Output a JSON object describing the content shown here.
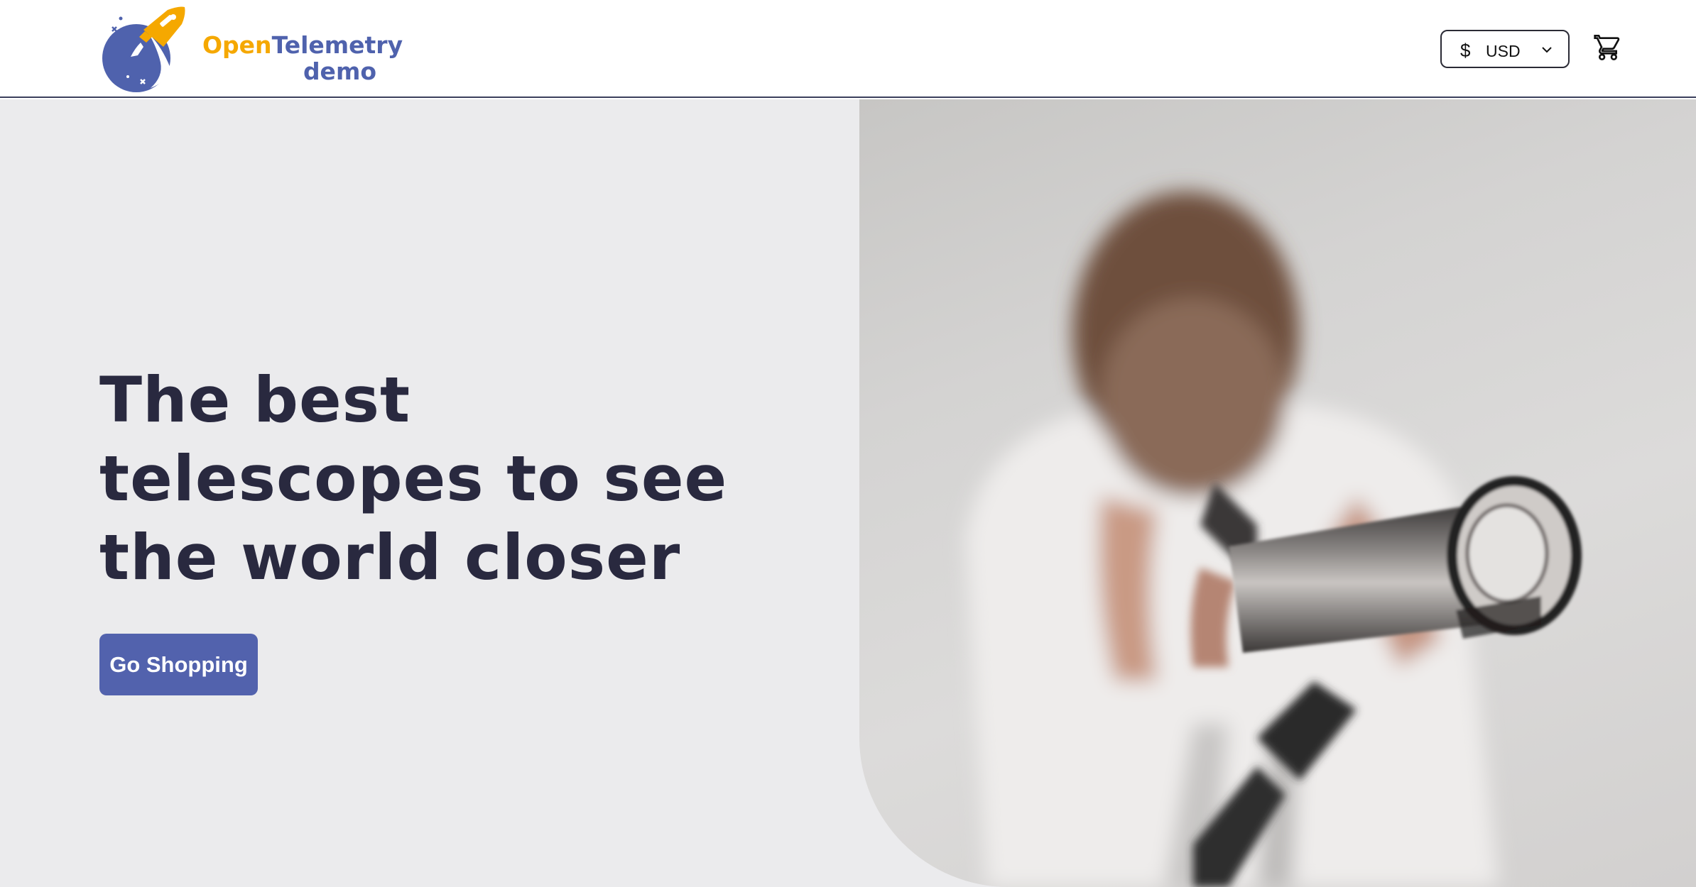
{
  "header": {
    "logo": {
      "word_open": "Open",
      "word_telemetry": "Telemetry",
      "word_demo": "demo",
      "icon": "rocket-planet-logo"
    },
    "currency_selector": {
      "symbol": "$",
      "code": "USD",
      "icon": "chevron-down-icon"
    },
    "cart": {
      "icon": "shopping-cart-icon"
    }
  },
  "hero": {
    "title": "The best telescopes to see the world closer",
    "button_label": "Go Shopping",
    "image": "child-looking-through-telescope"
  },
  "colors": {
    "brand_blue": "#5262ad",
    "brand_orange": "#f5a800",
    "heading": "#29293f",
    "hero_bg": "#ebebed"
  }
}
